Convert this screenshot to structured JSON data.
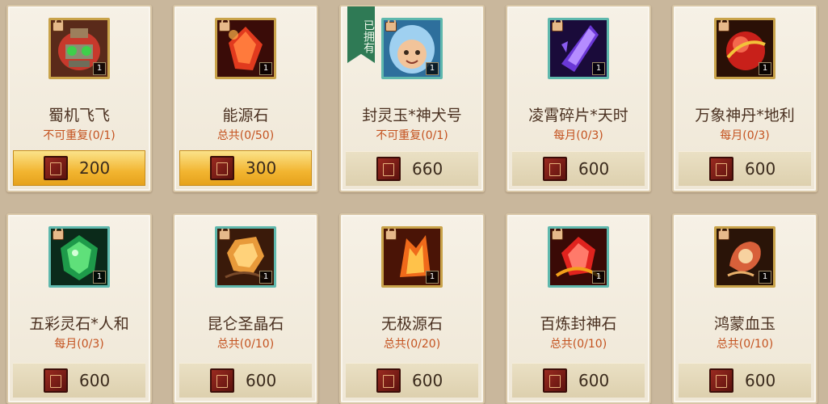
{
  "accent_colors": {
    "gold": "#f2b531",
    "limit_text": "#c4521f",
    "owned_badge": "#2f7a55"
  },
  "cards": [
    {
      "name": "蜀机飞飞",
      "limit": "不可重复(0/1)",
      "price": "200",
      "count": "1",
      "highlighted": true,
      "owned": false,
      "icon": "mech-pet-icon"
    },
    {
      "name": "能源石",
      "limit": "总共(0/50)",
      "price": "300",
      "count": "1",
      "highlighted": true,
      "owned": false,
      "icon": "energy-stone-icon"
    },
    {
      "name": "封灵玉*神犬号",
      "limit": "不可重复(0/1)",
      "price": "660",
      "count": "1",
      "highlighted": false,
      "owned": true,
      "owned_label": "已拥有",
      "icon": "dog-hood-avatar-icon"
    },
    {
      "name": "凌霄碎片*天时",
      "limit": "每月(0/3)",
      "price": "600",
      "count": "1",
      "highlighted": false,
      "owned": false,
      "icon": "purple-crystal-icon"
    },
    {
      "name": "万象神丹*地利",
      "limit": "每月(0/3)",
      "price": "600",
      "count": "1",
      "highlighted": false,
      "owned": false,
      "icon": "red-orb-icon"
    },
    {
      "name": "五彩灵石*人和",
      "limit": "每月(0/3)",
      "price": "600",
      "count": "1",
      "highlighted": false,
      "owned": false,
      "icon": "green-gem-icon"
    },
    {
      "name": "昆仑圣晶石",
      "limit": "总共(0/10)",
      "price": "600",
      "count": "1",
      "highlighted": false,
      "owned": false,
      "icon": "gold-crystal-icon"
    },
    {
      "name": "无极源石",
      "limit": "总共(0/20)",
      "price": "600",
      "count": "1",
      "highlighted": false,
      "owned": false,
      "icon": "flame-crystal-icon"
    },
    {
      "name": "百炼封神石",
      "limit": "总共(0/10)",
      "price": "600",
      "count": "1",
      "highlighted": false,
      "owned": false,
      "icon": "ruby-gem-icon"
    },
    {
      "name": "鸿蒙血玉",
      "limit": "总共(0/10)",
      "price": "600",
      "count": "1",
      "highlighted": false,
      "owned": false,
      "icon": "blood-jade-icon"
    }
  ],
  "currency_icon": "red-book-currency-icon"
}
